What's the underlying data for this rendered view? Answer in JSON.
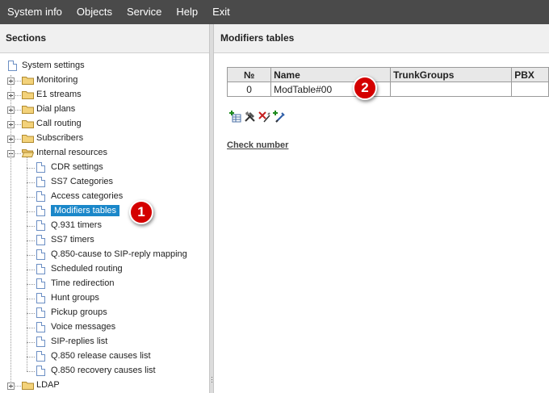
{
  "menu": [
    "System info",
    "Objects",
    "Service",
    "Help",
    "Exit"
  ],
  "left_panel": {
    "title": "Sections",
    "tree": {
      "root": "System settings",
      "folders": [
        {
          "label": "Monitoring",
          "expanded": false
        },
        {
          "label": "E1 streams",
          "expanded": false
        },
        {
          "label": "Dial plans",
          "expanded": false
        },
        {
          "label": "Call routing",
          "expanded": false
        },
        {
          "label": "Subscribers",
          "expanded": false
        },
        {
          "label": "Internal resources",
          "expanded": true
        }
      ],
      "internal_resources_items": [
        "CDR settings",
        "SS7 Categories",
        "Access categories",
        "Modifiers tables",
        "Q.931 timers",
        "SS7 timers",
        "Q.850-cause to SIP-reply mapping",
        "Scheduled routing",
        "Time redirection",
        "Hunt groups",
        "Pickup groups",
        "Voice messages",
        "SIP-replies list",
        "Q.850 release causes list",
        "Q.850 recovery causes list"
      ],
      "selected": "Modifiers tables",
      "after": {
        "label": "LDAP",
        "expanded": false
      }
    }
  },
  "right_panel": {
    "title": "Modifiers tables",
    "table": {
      "columns": [
        "№",
        "Name",
        "TrunkGroups",
        "PBX"
      ],
      "rows": [
        [
          "0",
          "ModTable#00",
          "",
          ""
        ]
      ]
    },
    "toolbar_icons": [
      "add-table-icon",
      "edit-tools-icon",
      "delete-table-icon",
      "copy-table-icon"
    ],
    "check_link": "Check number"
  },
  "callouts": [
    "1",
    "2"
  ],
  "colors": {
    "menubar": "#4a4a4a",
    "selection": "#1a87c9",
    "callout": "#d40000",
    "folder": "#f3d27a"
  }
}
